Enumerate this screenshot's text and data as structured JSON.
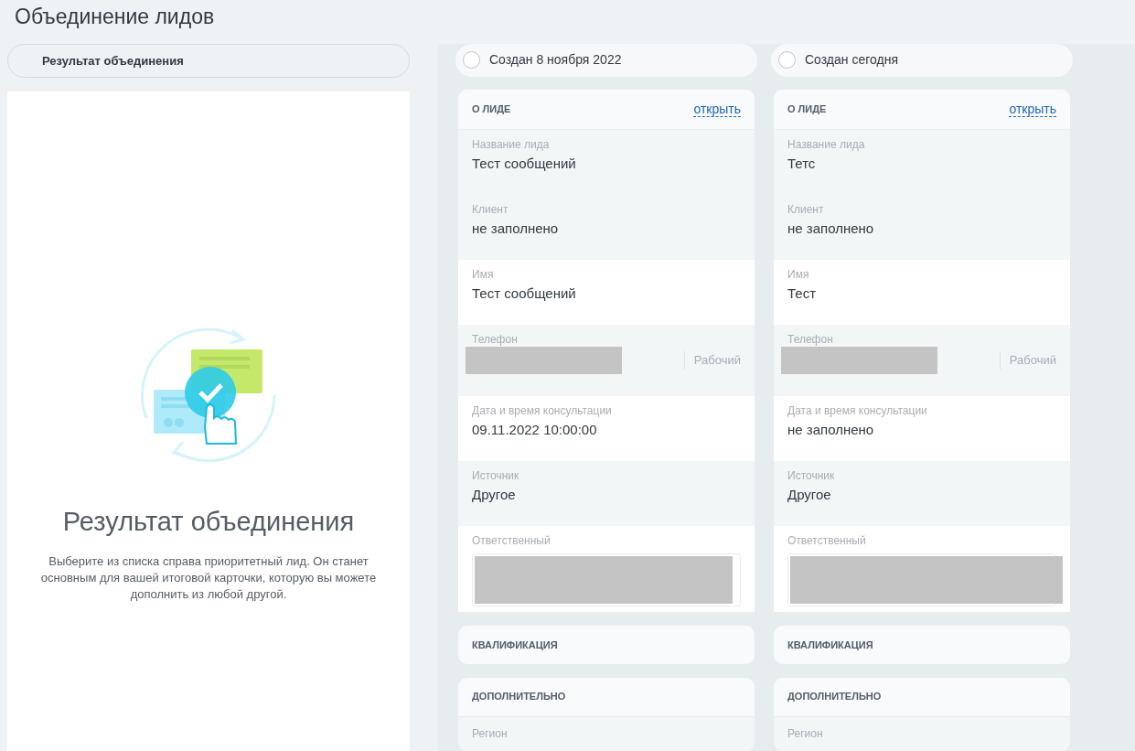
{
  "title": "Объединение лидов",
  "result": {
    "tab": "Результат объединения",
    "heading": "Результат объединения",
    "description": "Выберите из списка справа приоритетный лид. Он станет основным для вашей итоговой карточки, которую вы можете дополнить из любой другой."
  },
  "leads": [
    {
      "option": {
        "label": "Создан 8 ноября 2022",
        "selected": false
      },
      "section": {
        "title": "О ЛИДЕ",
        "link": "открыть"
      },
      "fields": [
        {
          "kind": "text",
          "label": "Название лида",
          "value": "Тест сообщений",
          "shaded": true
        },
        {
          "kind": "text",
          "label": "Клиент",
          "value": "не заполнено",
          "shaded": true
        },
        {
          "kind": "text",
          "label": "Имя",
          "value": "Тест сообщений",
          "shaded": false
        },
        {
          "kind": "phone",
          "label": "Телефон",
          "type": "Рабочий",
          "shaded": true
        },
        {
          "kind": "text",
          "label": "Дата и время консультации",
          "value": "09.11.2022 10:00:00",
          "shaded": false
        },
        {
          "kind": "text",
          "label": "Источник",
          "value": "Другое",
          "shaded": true
        },
        {
          "kind": "user",
          "label": "Ответственный",
          "shaded": false
        }
      ],
      "sections": [
        {
          "title": "КВАЛИФИКАЦИЯ"
        },
        {
          "title": "ДОПОЛНИТЕЛЬНО",
          "fields": [
            "Регион"
          ]
        }
      ]
    },
    {
      "option": {
        "label": "Создан сегодня",
        "selected": false
      },
      "section": {
        "title": "О ЛИДЕ",
        "link": "открыть"
      },
      "fields": [
        {
          "kind": "text",
          "label": "Название лида",
          "value": "Тетс",
          "shaded": true
        },
        {
          "kind": "text",
          "label": "Клиент",
          "value": "не заполнено",
          "shaded": true
        },
        {
          "kind": "text",
          "label": "Имя",
          "value": "Тест",
          "shaded": false
        },
        {
          "kind": "phone",
          "label": "Телефон",
          "type": "Рабочий",
          "shaded": true
        },
        {
          "kind": "text",
          "label": "Дата и время консультации",
          "value": "не заполнено",
          "shaded": false
        },
        {
          "kind": "text",
          "label": "Источник",
          "value": "Другое",
          "shaded": true
        },
        {
          "kind": "user",
          "label": "Ответственный",
          "shaded": false
        }
      ],
      "sections": [
        {
          "title": "КВАЛИФИКАЦИЯ"
        },
        {
          "title": "ДОПОЛНИТЕЛЬНО",
          "fields": [
            "Регион"
          ]
        }
      ]
    }
  ]
}
